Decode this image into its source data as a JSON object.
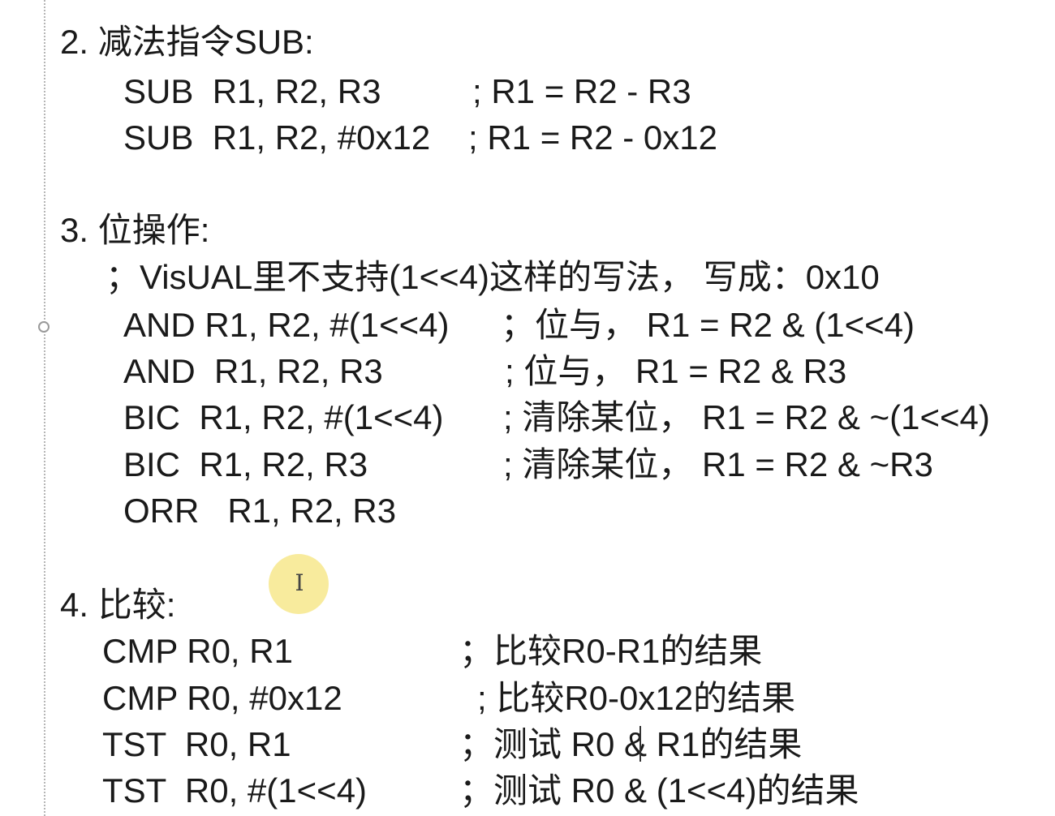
{
  "sections": {
    "sub": {
      "heading": "2. 减法指令SUB:",
      "lines": [
        {
          "code": "SUB  R1, R2, R3",
          "comment": "; R1 = R2 - R3"
        },
        {
          "code": "SUB  R1, R2, #0x12",
          "comment": "; R1 = R2 - 0x12"
        }
      ]
    },
    "bitops": {
      "heading": "3. 位操作:",
      "note": "；VisUAL里不支持(1<<4)这样的写法， 写成：0x10",
      "lines": [
        {
          "code": "AND R1, R2, #(1<<4)",
          "comment": "；位与， R1 = R2 & (1<<4)"
        },
        {
          "code": "AND  R1, R2, R3",
          "comment": "; 位与， R1 = R2 & R3"
        },
        {
          "code": "BIC  R1, R2, #(1<<4)",
          "comment": "; 清除某位， R1 = R2 & ~(1<<4)"
        },
        {
          "code": "BIC  R1, R2, R3",
          "comment": "; 清除某位， R1 = R2 & ~R3"
        },
        {
          "code": "ORR   R1, R2, R3",
          "comment": ""
        }
      ]
    },
    "compare": {
      "heading": "4. 比较:",
      "lines": [
        {
          "code": "CMP R0, R1",
          "comment": "；比较R0-R1的结果"
        },
        {
          "code": "CMP R0, #0x12",
          "comment": "; 比较R0-0x12的结果"
        },
        {
          "code": "TST  R0, R1",
          "comment": "；测试 R0 & R1的结果"
        },
        {
          "code": "TST  R0, #(1<<4)",
          "comment": "；测试 R0 & (1<<4)的结果"
        }
      ]
    }
  },
  "colors": {
    "text": "#1a1a1a",
    "cursor_highlight": "#f7e88c",
    "margin_rule": "#b5b5b5"
  },
  "icons": {
    "cursor": "i-beam-cursor-icon",
    "margin_handle": "margin-handle-icon"
  }
}
